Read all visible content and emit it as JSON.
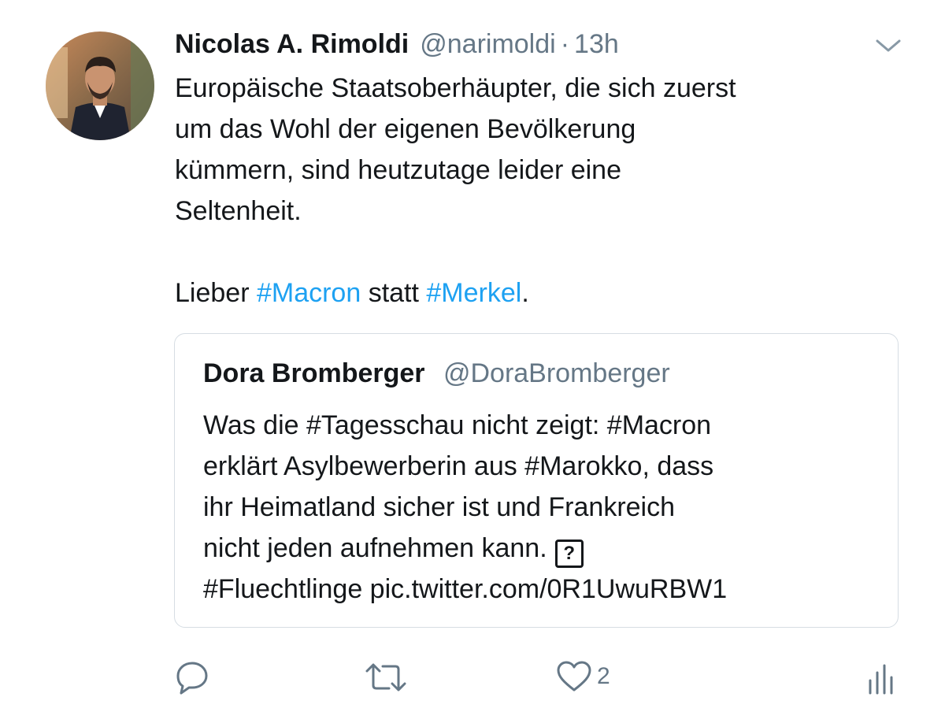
{
  "tweet": {
    "author_name": "Nicolas A. Rimoldi",
    "author_handle": "@narimoldi",
    "separator": "·",
    "time": "13h",
    "text_lines": [
      "Europäische Staatsoberhäupter, die sich zuerst",
      "um das Wohl der eigenen Bevölkerung",
      "kümmern, sind heutzutage leider eine",
      "Seltenheit."
    ],
    "second_para": {
      "before": "Lieber ",
      "hashtag1": "#Macron",
      "middle": " statt ",
      "hashtag2": "#Merkel",
      "after": "."
    }
  },
  "quoted_tweet": {
    "author_name": "Dora Bromberger",
    "author_handle": "@DoraBromberger",
    "text_lines": [
      "Was die #Tagesschau nicht zeigt: #Macron",
      "erklärt Asylbewerberin aus #Marokko, dass",
      "ihr Heimatland sicher ist und Frankreich",
      "nicht jeden aufnehmen kann.",
      "#Fluechtlinge pic.twitter.com/0R1UwuRBW1"
    ],
    "emoji_placeholder": "?"
  },
  "actions": {
    "reply_icon": "reply-icon",
    "retweet_icon": "retweet-icon",
    "like_icon": "heart-icon",
    "like_count": "2",
    "analytics_icon": "analytics-icon"
  },
  "colors": {
    "text": "#14171a",
    "secondary": "#657786",
    "link": "#1da1f2",
    "border": "#d6dde3"
  }
}
